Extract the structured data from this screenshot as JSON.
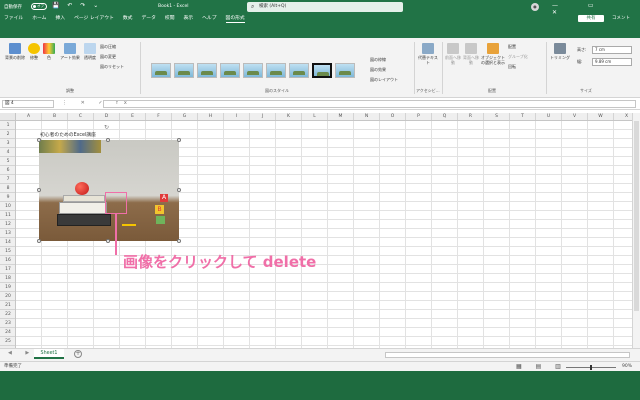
{
  "titlebar": {
    "autosave_label": "自動保存",
    "autosave_state": "オフ",
    "qat": "💾 ↶ ↷ ⌄",
    "book_title": "Book1 - Excel",
    "search_placeholder": "検索 (Alt+Q)",
    "window_controls": "— ▭ ✕"
  },
  "tabs": {
    "items": [
      "ファイル",
      "ホーム",
      "挿入",
      "ページ レイアウト",
      "数式",
      "データ",
      "校閲",
      "表示",
      "ヘルプ",
      "図の形式"
    ],
    "share": "共有",
    "comment": "コメント"
  },
  "ribbon": {
    "adjust": {
      "remove_bg": "背景の削除",
      "corrections": "修整",
      "color": "色",
      "artistic": "アート効果",
      "transparency": "透明度",
      "compress": "図の圧縮",
      "change": "図の変更",
      "reset": "図のリセット",
      "group_label": "調整"
    },
    "styles": {
      "border": "図の枠線",
      "effects": "図の効果",
      "layout": "図のレイアウト",
      "group_label": "図のスタイル"
    },
    "accessibility": {
      "alt_text": "代替テキスト",
      "group_label": "アクセシビ..."
    },
    "arrange": {
      "forward": "前面へ移動",
      "backward": "背面へ移動",
      "selection_pane": "オブジェクトの選択と表示",
      "align": "配置",
      "group": "グループ化",
      "rotate": "回転",
      "group_label": "配置"
    },
    "size": {
      "crop": "トリミング",
      "height_label": "高さ:",
      "height_value": "7 cm",
      "width_label": "幅:",
      "width_value": "9.89 cm",
      "group_label": "サイズ"
    }
  },
  "formula": {
    "namebox": "図 4",
    "icons": "⋮ ✕ ✓ fx"
  },
  "columns": [
    "A",
    "B",
    "C",
    "D",
    "E",
    "F",
    "G",
    "H",
    "I",
    "J",
    "K",
    "L",
    "M",
    "N",
    "O",
    "P",
    "Q",
    "R",
    "S",
    "T",
    "U",
    "V",
    "W",
    "X"
  ],
  "rows": [
    "1",
    "2",
    "3",
    "4",
    "5",
    "6",
    "7",
    "8",
    "9",
    "10",
    "11",
    "12",
    "13",
    "14",
    "15",
    "16",
    "17",
    "18",
    "19",
    "20",
    "21",
    "22",
    "23",
    "24",
    "25"
  ],
  "cells": {
    "b2": "初心者のためのExcel講座"
  },
  "picture": {
    "block_a": "A",
    "block_b": "B"
  },
  "annotation": "画像をクリックして delete",
  "sheets": {
    "nav": "◀ ▶",
    "tab": "Sheet1",
    "add": "+"
  },
  "status": {
    "ready": "準備完了",
    "views": "▦ ▤ ▥",
    "zoom": "90%"
  },
  "colors": {
    "excel_green": "#217346",
    "annotation_pink": "#f06fa8"
  }
}
